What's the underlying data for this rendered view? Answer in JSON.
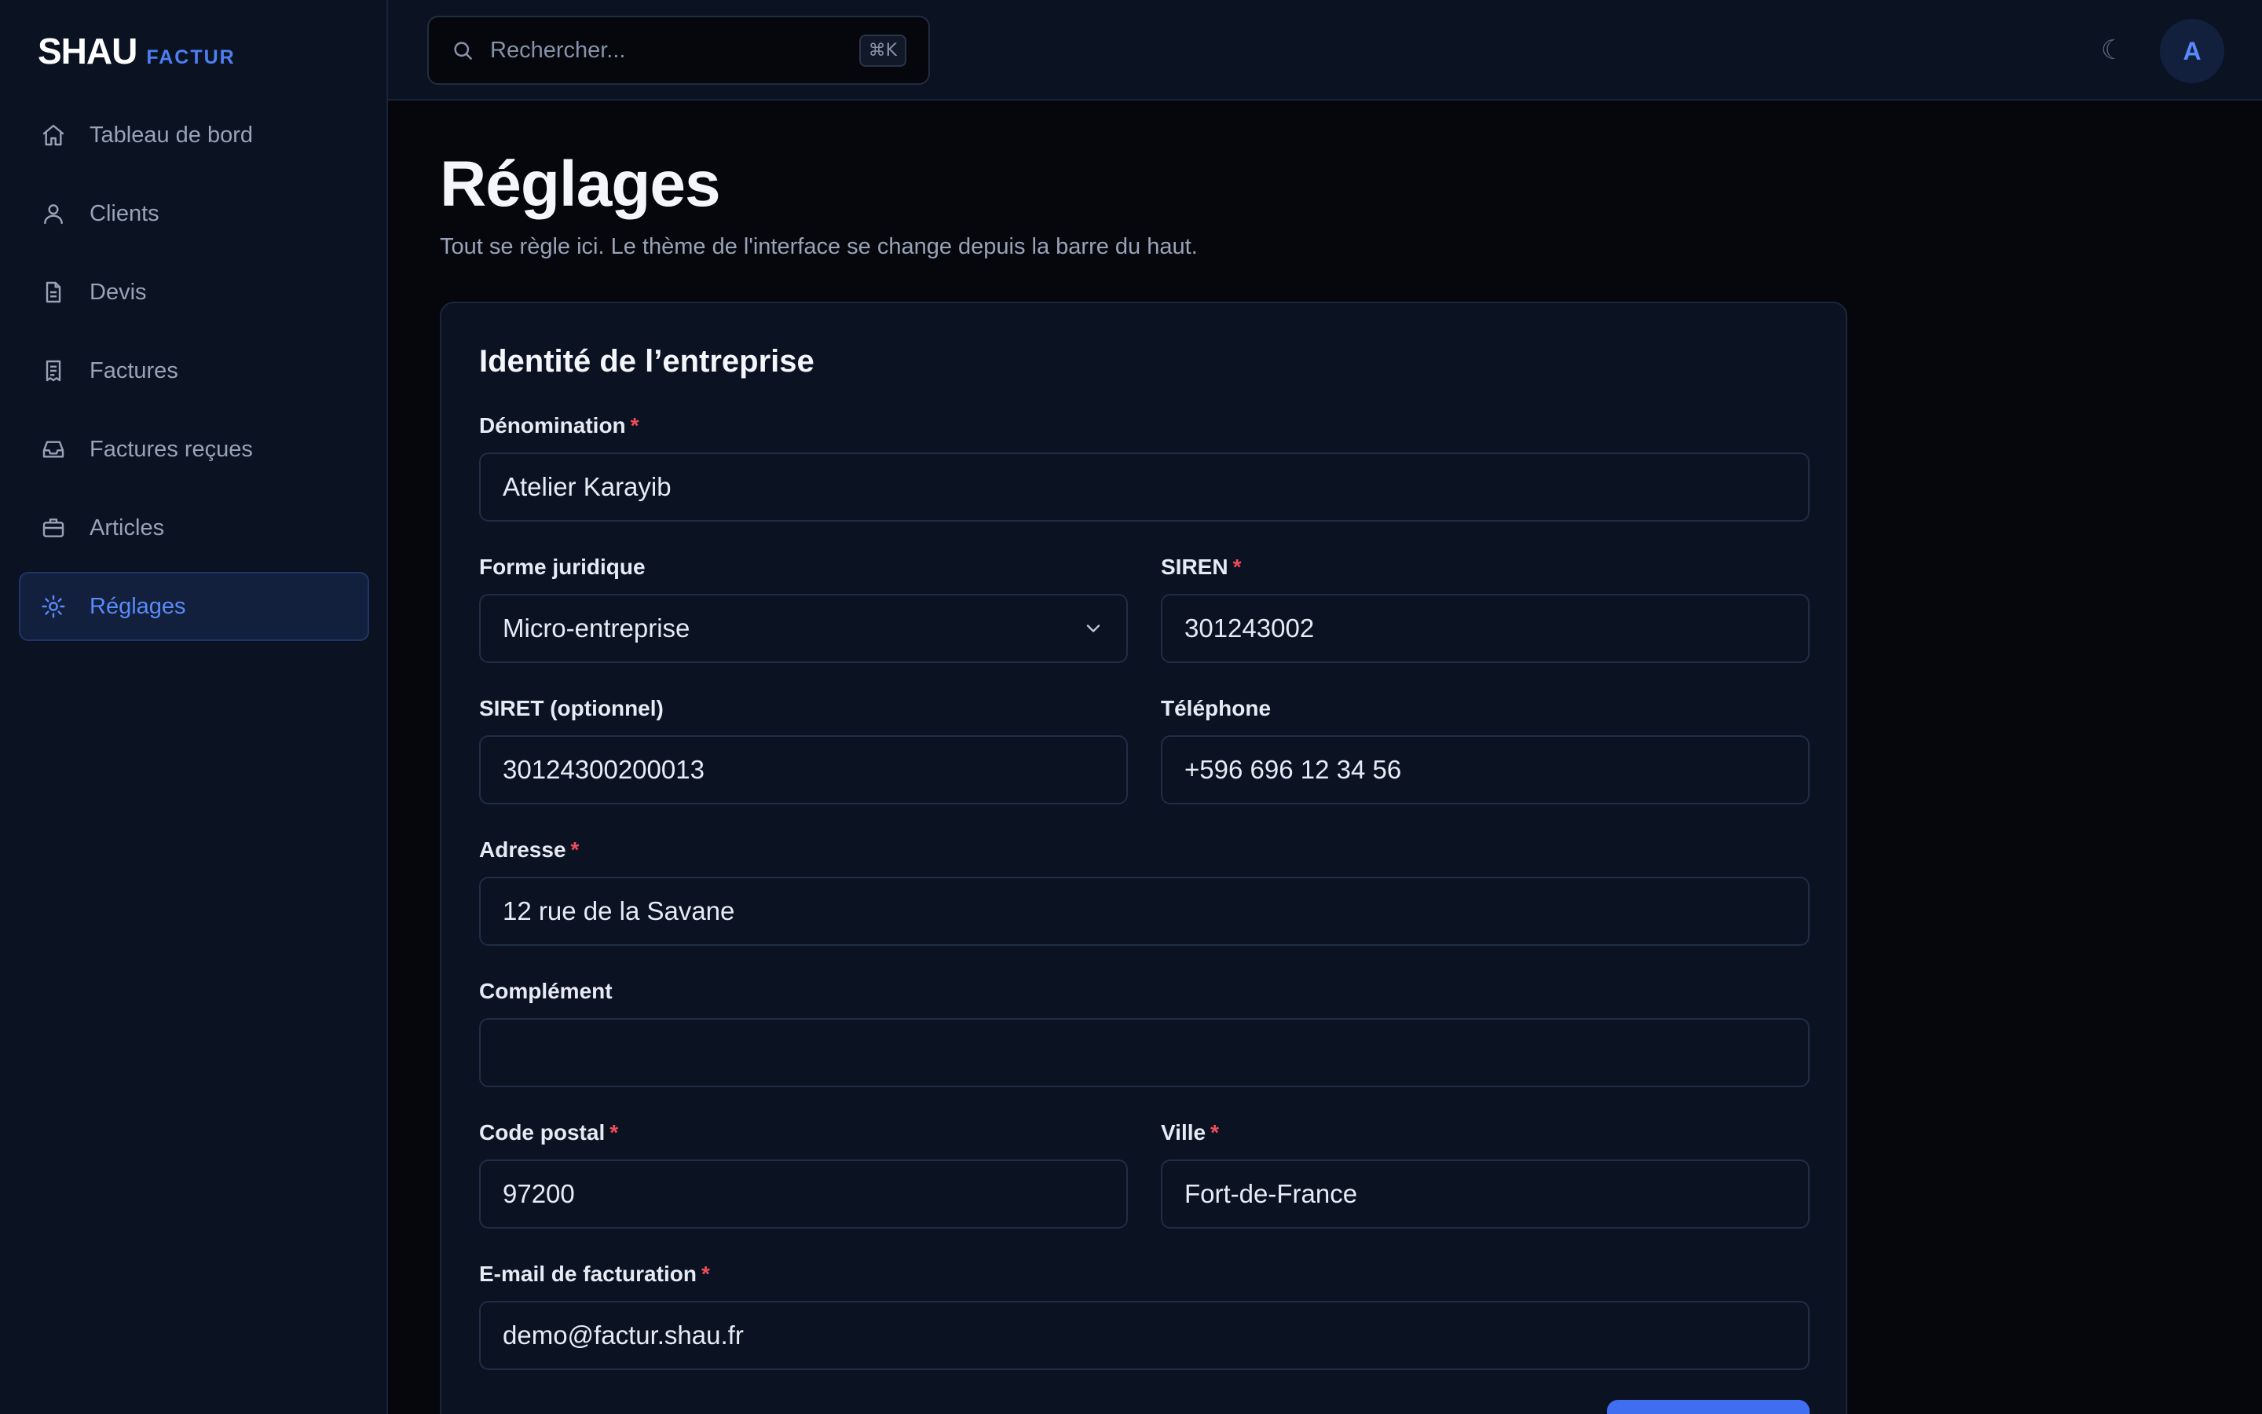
{
  "brand": {
    "main": "SHAU",
    "sub": "FACTUR"
  },
  "sidebar": {
    "items": [
      {
        "label": "Tableau de bord",
        "icon": "home-icon"
      },
      {
        "label": "Clients",
        "icon": "user-icon"
      },
      {
        "label": "Devis",
        "icon": "document-icon"
      },
      {
        "label": "Factures",
        "icon": "receipt-icon"
      },
      {
        "label": "Factures reçues",
        "icon": "inbox-icon"
      },
      {
        "label": "Articles",
        "icon": "briefcase-icon"
      },
      {
        "label": "Réglages",
        "icon": "gear-icon",
        "active": true
      }
    ]
  },
  "topbar": {
    "search_placeholder": "Rechercher...",
    "search_shortcut": "⌘K",
    "theme_icon": "☾",
    "avatar_initial": "A"
  },
  "page": {
    "title": "Réglages",
    "subtitle": "Tout se règle ici. Le thème de l'interface se change depuis la barre du haut."
  },
  "form": {
    "title": "Identité de l’entreprise",
    "denomination": {
      "label": "Dénomination",
      "value": "Atelier Karayib",
      "required": true
    },
    "forme": {
      "label": "Forme juridique",
      "value": "Micro-entreprise"
    },
    "siren": {
      "label": "SIREN",
      "value": "301243002",
      "required": true
    },
    "siret": {
      "label": "SIRET (optionnel)",
      "value": "30124300200013"
    },
    "telephone": {
      "label": "Téléphone",
      "value": "+596 696 12 34 56"
    },
    "adresse": {
      "label": "Adresse",
      "value": "12 rue de la Savane",
      "required": true
    },
    "complement": {
      "label": "Complément",
      "value": ""
    },
    "code_postal": {
      "label": "Code postal",
      "value": "97200",
      "required": true
    },
    "ville": {
      "label": "Ville",
      "value": "Fort-de-France",
      "required": true
    },
    "email": {
      "label": "E-mail de facturation",
      "value": "demo@factur.shau.fr",
      "required": true
    },
    "required_mark": "*"
  },
  "colors": {
    "accent": "#4d7ff0",
    "required": "#ef4d5a",
    "background": "#05070d",
    "panel": "#0b1222"
  }
}
